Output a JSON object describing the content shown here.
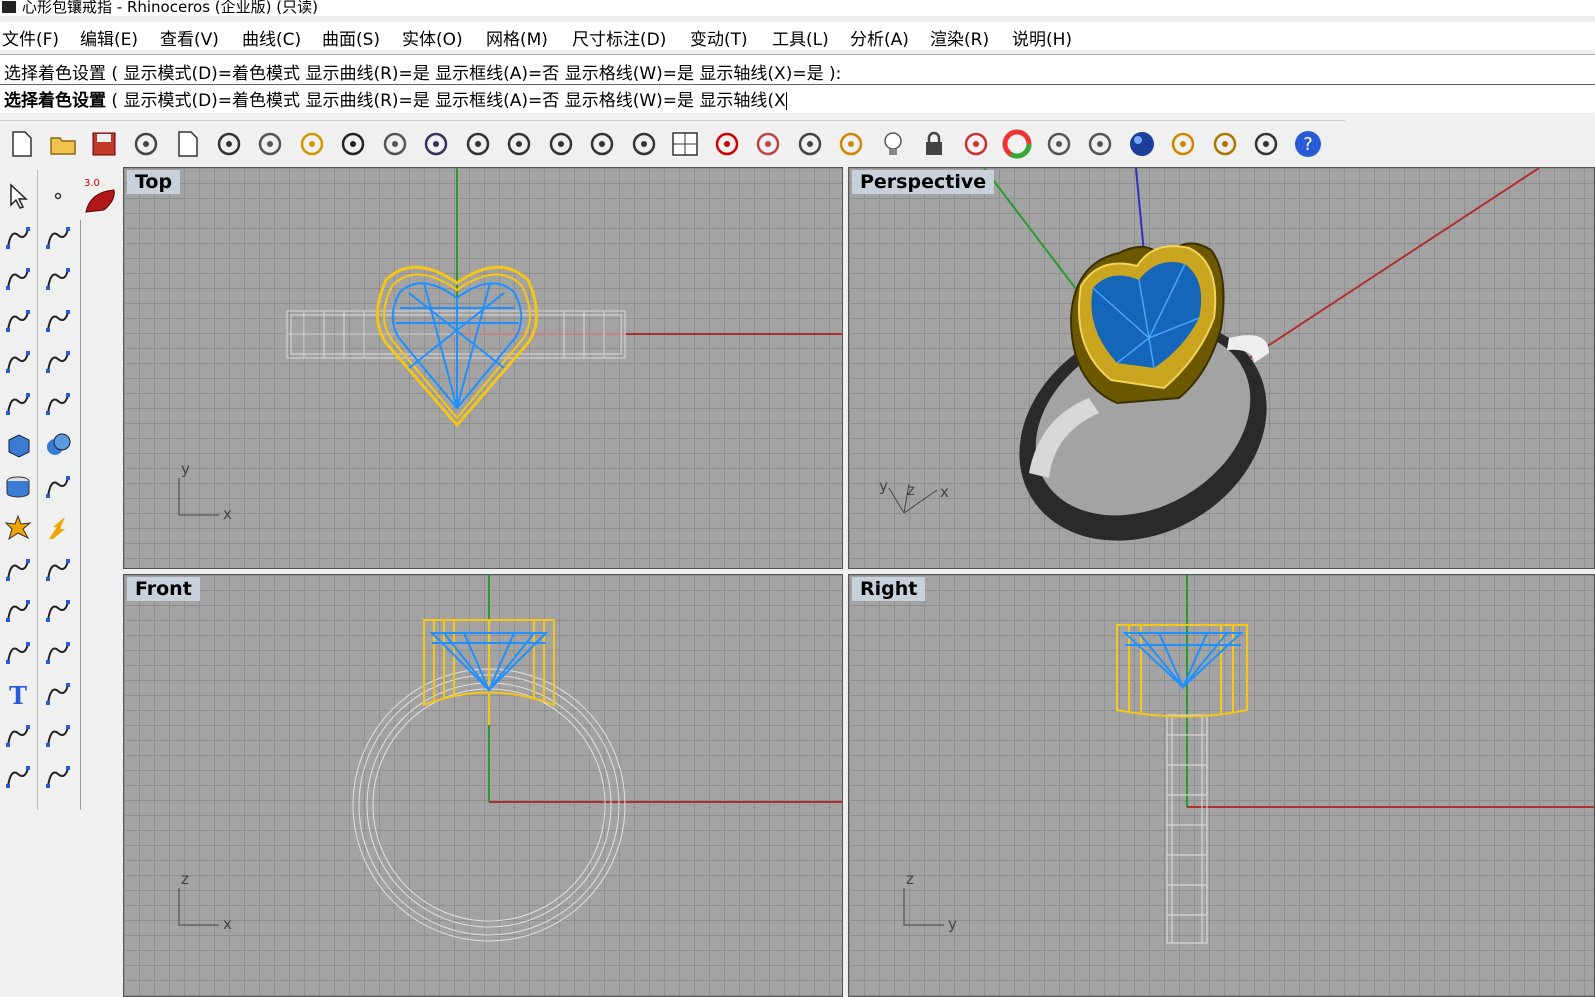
{
  "window": {
    "title": "心形包镶戒指 - Rhinoceros (企业版) (只读)"
  },
  "menubar": [
    "文件(F)",
    "编辑(E)",
    "查看(V)",
    "曲线(C)",
    "曲面(S)",
    "实体(O)",
    "网格(M)",
    "尺寸标注(D)",
    "变动(T)",
    "工具(L)",
    "分析(A)",
    "渲染(R)",
    "说明(H)"
  ],
  "command": {
    "history": "选择着色设置 ( 显示模式(D)=着色模式  显示曲线(R)=是  显示框线(A)=否  显示格线(W)=是  显示轴线(X)=是 ):",
    "prompt_bold": "选择着色设置",
    "prompt_rest": " ( 显示模式(D)=着色模式  显示曲线(R)=是  显示框线(A)=否  显示格线(W)=是  显示轴线(X"
  },
  "toolbar_top_icons": [
    "new-file-icon",
    "open-folder-icon",
    "save-icon",
    "print-icon",
    "import-icon",
    "cut-icon",
    "copy-icon",
    "paste-icon",
    "undo-icon",
    "pan-hand-icon",
    "rotate-view-icon",
    "zoom-dynamic-icon",
    "zoom-window-icon",
    "zoom-extents-icon",
    "zoom-selected-icon",
    "rotate-camera-icon",
    "four-viewports-icon",
    "car-icon",
    "render-mesh-icon",
    "target-icon",
    "points-icon",
    "lightbulb-icon",
    "lock-icon",
    "layer-icon",
    "color-wheel-icon",
    "wireframe-sphere-icon",
    "grid-sphere-icon",
    "render-sphere-icon",
    "light-icon",
    "gear-cluster-icon",
    "options-icon",
    "help-icon"
  ],
  "toolbar_left_icons": [
    "select-arrow-icon",
    "point-icon",
    "polyline-icon",
    "curve-icon",
    "circle-icon",
    "ellipse-icon",
    "arc-icon",
    "rectangle-icon",
    "polygon-icon",
    "fillet-icon",
    "surface-icon",
    "patch-icon",
    "box-icon",
    "sphere-icon",
    "cylinder-icon",
    "plane-icon",
    "explode-icon",
    "split-icon",
    "trim-icon",
    "extend-icon",
    "boolean-icon",
    "group-icon",
    "offset-icon",
    "sweep-icon",
    "text-icon",
    "scale-icon",
    "array-icon",
    "mirror-icon",
    "block-icon",
    "dimension-icon"
  ],
  "badge_3d": "3.0",
  "viewports": {
    "top": {
      "label": "Top",
      "axis_h": "x",
      "axis_v": "y"
    },
    "perspective": {
      "label": "Perspective",
      "axis_x": "x",
      "axis_y": "y",
      "axis_z": "z"
    },
    "front": {
      "label": "Front",
      "axis_h": "x",
      "axis_v": "z"
    },
    "right": {
      "label": "Right",
      "axis_h": "y",
      "axis_v": "z"
    }
  },
  "colors": {
    "viewport_bg": "#a3a3a3",
    "grid": "#8f8f8f",
    "x_axis": "#b03030",
    "y_axis": "#2a9a2a",
    "z_axis": "#3030c0",
    "gold_wire": "#f5c518",
    "gem_wire": "#1e90ff",
    "ring_wire": "#d8d8d8",
    "label_bg": "#c8d0dc"
  }
}
